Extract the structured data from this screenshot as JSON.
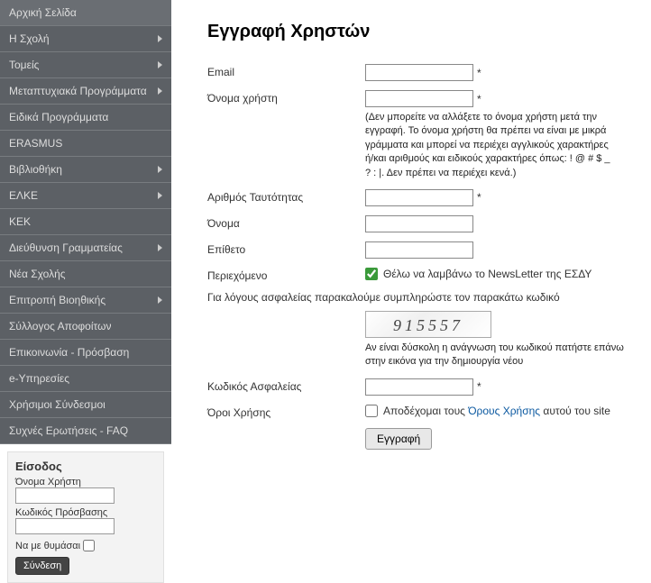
{
  "sidebar": {
    "items": [
      {
        "label": "Αρχική Σελίδα",
        "hasSub": false
      },
      {
        "label": "Η Σχολή",
        "hasSub": true
      },
      {
        "label": "Τομείς",
        "hasSub": true
      },
      {
        "label": "Μεταπτυχιακά Προγράμματα",
        "hasSub": true
      },
      {
        "label": "Ειδικά Προγράμματα",
        "hasSub": false
      },
      {
        "label": "ERASMUS",
        "hasSub": false
      },
      {
        "label": "Βιβλιοθήκη",
        "hasSub": true
      },
      {
        "label": "ΕΛΚΕ",
        "hasSub": true
      },
      {
        "label": "ΚΕΚ",
        "hasSub": false
      },
      {
        "label": "Διεύθυνση Γραμματείας",
        "hasSub": true
      },
      {
        "label": "Νέα Σχολής",
        "hasSub": false
      },
      {
        "label": "Επιτροπή Βιοηθικής",
        "hasSub": true
      },
      {
        "label": "Σύλλογος Αποφοίτων",
        "hasSub": false
      },
      {
        "label": "Επικοινωνία - Πρόσβαση",
        "hasSub": false
      },
      {
        "label": "e-Υπηρεσίες",
        "hasSub": false
      },
      {
        "label": "Χρήσιμοι Σύνδεσμοι",
        "hasSub": false
      },
      {
        "label": "Συχνές Ερωτήσεις - FAQ",
        "hasSub": false
      }
    ]
  },
  "login": {
    "title": "Είσοδος",
    "user_label": "Όνομα Χρήστη",
    "pass_label": "Κωδικός Πρόσβασης",
    "remember_label": "Να με θυμάσαι",
    "submit": "Σύνδεση"
  },
  "main": {
    "title": "Εγγραφή Χρηστών",
    "email_label": "Email",
    "username_label": "Όνομα χρήστη",
    "username_hint": "(Δεν μπορείτε να αλλάξετε το όνομα χρήστη μετά την εγγραφή. Το όνομα χρήστη θα πρέπει να είναι με μικρά γράμματα και μπορεί να περιέχει αγγλικούς χαρακτήρες ή/και αριθμούς και ειδικούς χαρακτήρες όπως: ! @ # $ _ ? : |. Δεν πρέπει να περιέχει κενά.)",
    "id_label": "Αριθμός Ταυτότητας",
    "firstname_label": "Όνομα",
    "lastname_label": "Επίθετο",
    "content_label": "Περιεχόμενο",
    "newsletter_text": "Θέλω να λαμβάνω το NewsLetter της ΕΣΔΥ",
    "security_note": "Για λόγους ασφαλείας παρακαλούμε συμπληρώστε τον παρακάτω κωδικό",
    "captcha_value": "915557",
    "captcha_hint": "Αν είναι δύσκολη η ανάγνωση του κωδικού πατήστε επάνω στην εικόνα για την δημιουργία νέου",
    "seccode_label": "Κωδικός Ασφαλείας",
    "terms_label": "Όροι Χρήσης",
    "terms_prefix": "Αποδέχομαι τους ",
    "terms_link": "Όρους Χρήσης",
    "terms_suffix": " αυτού του site",
    "submit": "Εγγραφή",
    "asterisk": "*"
  }
}
